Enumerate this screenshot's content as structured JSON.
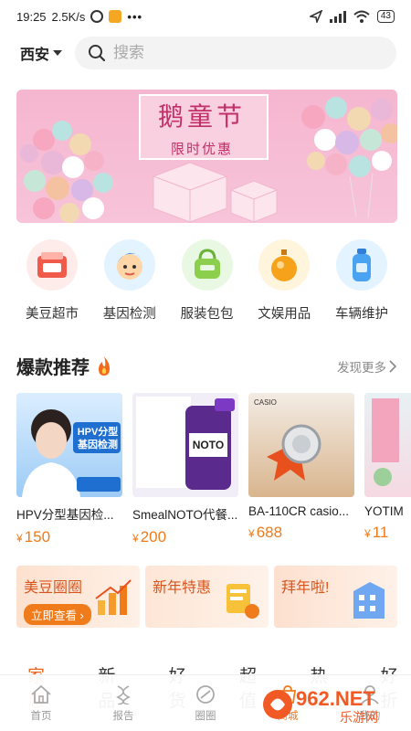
{
  "status_bar": {
    "time": "19:25",
    "speed": "2.5K/s",
    "battery": "43"
  },
  "header": {
    "city": "西安",
    "search_placeholder": "搜索"
  },
  "banner": {
    "title": "鹅童节",
    "subtitle": "限时优惠"
  },
  "categories": [
    {
      "label": "美豆超市",
      "icon": "supermarket-icon",
      "color": "#fdecea"
    },
    {
      "label": "基因检测",
      "icon": "gene-test-icon",
      "color": "#e3f3ff"
    },
    {
      "label": "服装包包",
      "icon": "bag-icon",
      "color": "#e9f8e3"
    },
    {
      "label": "文娱用品",
      "icon": "perfume-icon",
      "color": "#fff4dc"
    },
    {
      "label": "车辆维护",
      "icon": "bottle-icon",
      "color": "#e3f3ff"
    }
  ],
  "hot_section": {
    "title": "爆款推荐",
    "more": "发现更多"
  },
  "products": [
    {
      "name": "HPV分型基因检...",
      "price": "150",
      "image_text": "HPV分型基因检测"
    },
    {
      "name": "SmealNOTO代餐...",
      "price": "200",
      "image_text": "NOTO"
    },
    {
      "name": "BA-110CR casio...",
      "price": "688",
      "image_text": "CASIO"
    },
    {
      "name": "YOTIM",
      "price": "11"
    }
  ],
  "currency": "¥",
  "promos": [
    {
      "title": "美豆圈圈",
      "button": "立即查看"
    },
    {
      "title": "新年特惠"
    },
    {
      "title": "拜年啦!"
    }
  ],
  "tabs": [
    "家惠",
    "新品",
    "好货",
    "超值",
    "热卖",
    "好折"
  ],
  "bottom_nav": [
    {
      "label": "首页",
      "icon": "home-icon"
    },
    {
      "label": "报告",
      "icon": "report-icon"
    },
    {
      "label": "圈圈",
      "icon": "circle-icon"
    },
    {
      "label": "商城",
      "icon": "shop-icon"
    },
    {
      "label": "我的",
      "icon": "user-icon"
    }
  ],
  "watermark": {
    "text": "962.NET",
    "sub": "乐游网"
  }
}
